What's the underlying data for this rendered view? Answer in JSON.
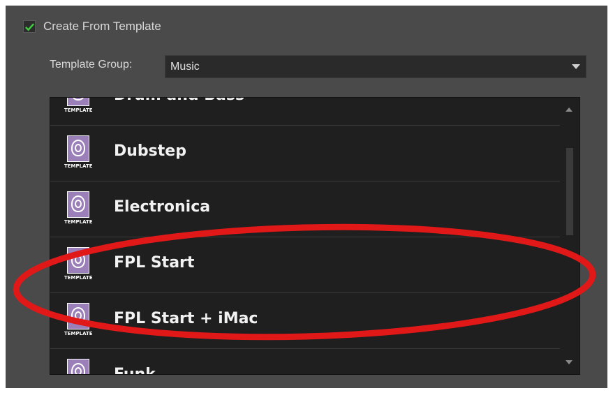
{
  "create_from_template": {
    "label": "Create From Template",
    "checked": true
  },
  "template_group": {
    "label": "Template Group:",
    "selected": "Music"
  },
  "icon_badge": "TEMPLATE",
  "templates": [
    {
      "label": "Drum and Bass",
      "icon": "template-icon"
    },
    {
      "label": "Dubstep",
      "icon": "template-icon"
    },
    {
      "label": "Electronica",
      "icon": "template-icon"
    },
    {
      "label": "FPL Start",
      "icon": "template-icon"
    },
    {
      "label": "FPL Start + iMac",
      "icon": "template-icon"
    },
    {
      "label": "Funk",
      "icon": "template-icon"
    }
  ],
  "colors": {
    "panel": "#4a4a4a",
    "list_bg": "#1f1f1f",
    "checkmark": "#3fcf3f",
    "icon_purple": "#9a7fb8",
    "annotation": "#e01818"
  },
  "annotation": "red-ellipse-highlight"
}
